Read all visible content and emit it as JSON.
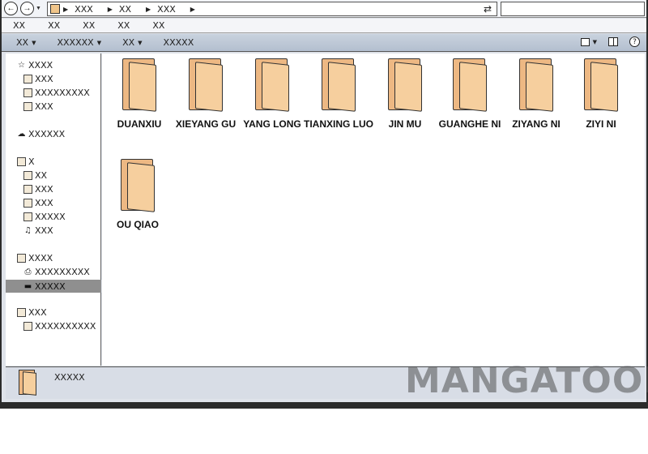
{
  "address": {
    "crumbs": [
      "XXX",
      "XX",
      "XXX"
    ]
  },
  "menu": [
    "XX",
    "XX",
    "XX",
    "XX",
    "XX"
  ],
  "commands": [
    {
      "label": "XX",
      "dropdown": true
    },
    {
      "label": "XXXXXX",
      "dropdown": true
    },
    {
      "label": "XX",
      "dropdown": true
    },
    {
      "label": "XXXXX",
      "dropdown": false
    }
  ],
  "sidebar": {
    "favorites": {
      "label": "XXXX",
      "items": [
        "XXX",
        "XXXXXXXXX",
        "XXX"
      ]
    },
    "libraries": {
      "label": "XXXXXX"
    },
    "computer": {
      "label": "X",
      "items": [
        "XX",
        "XXX",
        "XXX",
        "XXXXX",
        "XXX"
      ]
    },
    "network": {
      "label": "XXXX",
      "items": [
        "XXXXXXXXX",
        "XXXXX"
      ]
    },
    "homegroup": {
      "label": "XXX",
      "items": [
        "XXXXXXXXXX"
      ]
    }
  },
  "folders": [
    {
      "name": "DUANXIU"
    },
    {
      "name": "XIEYANG GU"
    },
    {
      "name": "YANG LONG"
    },
    {
      "name": "TIANXING LUO"
    },
    {
      "name": "JIN MU"
    },
    {
      "name": "GUANGHE NI"
    },
    {
      "name": "ZIYANG NI"
    },
    {
      "name": "ZIYI NI"
    },
    {
      "name": "OU QIAO"
    }
  ],
  "details": {
    "text": "XXXXX"
  },
  "watermark": "MANGATOON",
  "colors": {
    "folder": "#f6cf9e",
    "folder_back": "#edb883",
    "selected": "#8f8f8f",
    "toolbar": "#c9d2de"
  }
}
